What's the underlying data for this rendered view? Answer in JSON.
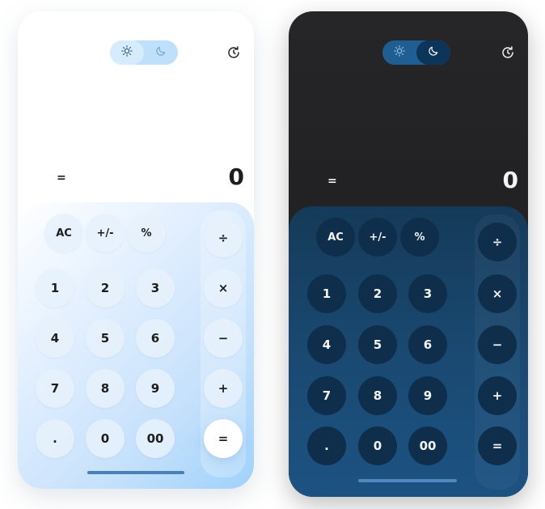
{
  "light": {
    "theme_label": "light",
    "display": {
      "equals": "=",
      "result": "0"
    },
    "fn_keys": [
      "AC",
      "+/-",
      "%"
    ],
    "digit_rows": [
      [
        "1",
        "2",
        "3"
      ],
      [
        "4",
        "5",
        "6"
      ],
      [
        "7",
        "8",
        "9"
      ],
      [
        ".",
        "0",
        "00"
      ]
    ],
    "op_keys": [
      "÷",
      "×",
      "−",
      "+",
      "="
    ],
    "colors": {
      "accent": "#9fd1fb",
      "toggle": "#bfe0fb"
    }
  },
  "dark": {
    "theme_label": "dark",
    "display": {
      "equals": "=",
      "result": "0"
    },
    "fn_keys": [
      "AC",
      "+/-",
      "%"
    ],
    "digit_rows": [
      [
        "1",
        "2",
        "3"
      ],
      [
        "4",
        "5",
        "6"
      ],
      [
        "7",
        "8",
        "9"
      ],
      [
        ".",
        "0",
        "00"
      ]
    ],
    "op_keys": [
      "÷",
      "×",
      "−",
      "+",
      "="
    ],
    "colors": {
      "accent": "#1c5282",
      "toggle": "#1e5e92"
    }
  },
  "icons": {
    "sun": "sun-icon",
    "moon": "moon-icon",
    "history": "history-icon"
  }
}
